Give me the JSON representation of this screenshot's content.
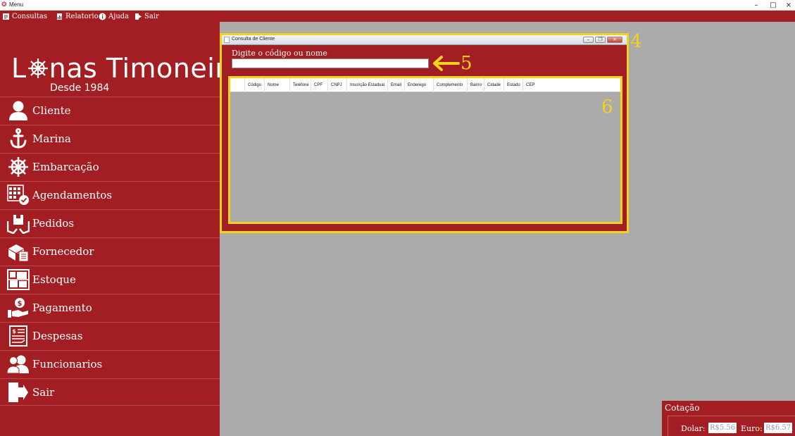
{
  "window": {
    "title": "Menu",
    "minimize": "–",
    "maximize": "□",
    "close": "×"
  },
  "menu": {
    "items": [
      {
        "label": "Consultas",
        "icon": "consultas-icon"
      },
      {
        "label": "Relatorio",
        "icon": "relatorio-icon"
      },
      {
        "label": "Ajuda",
        "icon": "info-icon"
      },
      {
        "label": "Sair",
        "icon": "exit-icon"
      }
    ]
  },
  "brand": {
    "name_left": "L",
    "name_right": "nas Timoneiro",
    "since": "Desde 1984"
  },
  "sidebar": {
    "items": [
      {
        "label": "Cliente",
        "icon": "user-icon"
      },
      {
        "label": "Marina",
        "icon": "anchor-icon"
      },
      {
        "label": "Embarcação",
        "icon": "ship-wheel-icon"
      },
      {
        "label": "Agendamentos",
        "icon": "calendar-icon"
      },
      {
        "label": "Pedidos",
        "icon": "orders-icon"
      },
      {
        "label": "Fornecedor",
        "icon": "supplier-icon"
      },
      {
        "label": "Estoque",
        "icon": "stock-icon"
      },
      {
        "label": "Pagamento",
        "icon": "payment-icon"
      },
      {
        "label": "Despesas",
        "icon": "expenses-icon"
      },
      {
        "label": "Funcionarios",
        "icon": "employees-icon"
      },
      {
        "label": "Sair",
        "icon": "exit-icon"
      }
    ]
  },
  "consulta": {
    "title": "Consulta de Cliente",
    "prompt": "Digite o código ou nome",
    "search_value": "",
    "columns": [
      "Código",
      "Nome",
      "Telefone",
      "CPF",
      "CNPJ",
      "Inscrição Estadual",
      "Email",
      "Enderego",
      "Complemento",
      "Bairro",
      "Cidade",
      "Estado",
      "CEP"
    ]
  },
  "annotations": {
    "window_marker": "4",
    "search_marker": "5",
    "grid_marker": "6"
  },
  "cotacao": {
    "title": "Cotação",
    "dolar_label": "Dolar:",
    "dolar_value": "R$5.56",
    "euro_label": "Euro:",
    "euro_value": "R$6.57"
  },
  "colors": {
    "brand_red": "#a31e23",
    "highlight_yellow": "#f2d21c",
    "mdi_gray": "#ababab"
  }
}
